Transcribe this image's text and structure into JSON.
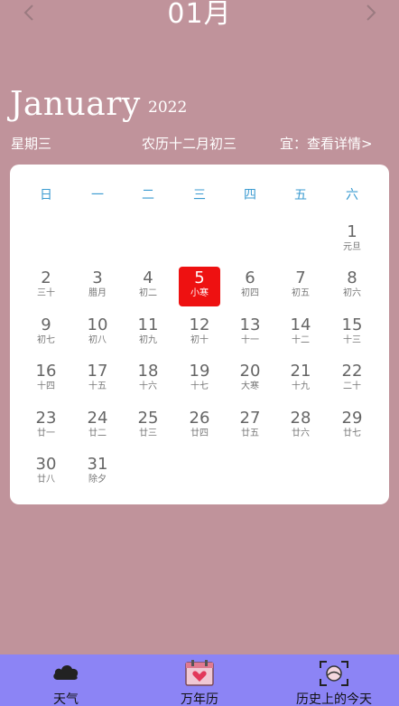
{
  "header": {
    "month_title": "01月",
    "english_month": "January",
    "year": "2022",
    "weekday": "星期三",
    "lunar_date": "农历十二月初三",
    "yi_link": "宜：查看详情>"
  },
  "calendar": {
    "week_headers": [
      "日",
      "一",
      "二",
      "三",
      "四",
      "五",
      "六"
    ],
    "days": [
      {
        "num": "1",
        "sub": "元旦",
        "col": 6,
        "row": 0
      },
      {
        "num": "2",
        "sub": "三十",
        "col": 0,
        "row": 1
      },
      {
        "num": "3",
        "sub": "腊月",
        "col": 1,
        "row": 1
      },
      {
        "num": "4",
        "sub": "初二",
        "col": 2,
        "row": 1
      },
      {
        "num": "5",
        "sub": "小寒",
        "col": 3,
        "row": 1,
        "today": true
      },
      {
        "num": "6",
        "sub": "初四",
        "col": 4,
        "row": 1
      },
      {
        "num": "7",
        "sub": "初五",
        "col": 5,
        "row": 1
      },
      {
        "num": "8",
        "sub": "初六",
        "col": 6,
        "row": 1
      },
      {
        "num": "9",
        "sub": "初七",
        "col": 0,
        "row": 2
      },
      {
        "num": "10",
        "sub": "初八",
        "col": 1,
        "row": 2
      },
      {
        "num": "11",
        "sub": "初九",
        "col": 2,
        "row": 2
      },
      {
        "num": "12",
        "sub": "初十",
        "col": 3,
        "row": 2
      },
      {
        "num": "13",
        "sub": "十一",
        "col": 4,
        "row": 2
      },
      {
        "num": "14",
        "sub": "十二",
        "col": 5,
        "row": 2
      },
      {
        "num": "15",
        "sub": "十三",
        "col": 6,
        "row": 2
      },
      {
        "num": "16",
        "sub": "十四",
        "col": 0,
        "row": 3
      },
      {
        "num": "17",
        "sub": "十五",
        "col": 1,
        "row": 3
      },
      {
        "num": "18",
        "sub": "十六",
        "col": 2,
        "row": 3
      },
      {
        "num": "19",
        "sub": "十七",
        "col": 3,
        "row": 3
      },
      {
        "num": "20",
        "sub": "大寒",
        "col": 4,
        "row": 3
      },
      {
        "num": "21",
        "sub": "十九",
        "col": 5,
        "row": 3
      },
      {
        "num": "22",
        "sub": "二十",
        "col": 6,
        "row": 3
      },
      {
        "num": "23",
        "sub": "廿一",
        "col": 0,
        "row": 4
      },
      {
        "num": "24",
        "sub": "廿二",
        "col": 1,
        "row": 4
      },
      {
        "num": "25",
        "sub": "廿三",
        "col": 2,
        "row": 4
      },
      {
        "num": "26",
        "sub": "廿四",
        "col": 3,
        "row": 4
      },
      {
        "num": "27",
        "sub": "廿五",
        "col": 4,
        "row": 4
      },
      {
        "num": "28",
        "sub": "廿六",
        "col": 5,
        "row": 4
      },
      {
        "num": "29",
        "sub": "廿七",
        "col": 6,
        "row": 4
      },
      {
        "num": "30",
        "sub": "廿八",
        "col": 0,
        "row": 5
      },
      {
        "num": "31",
        "sub": "除夕",
        "col": 1,
        "row": 5
      }
    ]
  },
  "bottom_nav": {
    "items": [
      {
        "label": "天气",
        "icon": "cloud-icon"
      },
      {
        "label": "万年历",
        "icon": "calendar-heart-icon"
      },
      {
        "label": "历史上的今天",
        "icon": "scan-frame-icon"
      }
    ]
  },
  "colors": {
    "background": "#c0939b",
    "card": "#ffffff",
    "week_header": "#3b9bd1",
    "today": "#ee1111",
    "bottom_nav": "#8c84f5"
  }
}
